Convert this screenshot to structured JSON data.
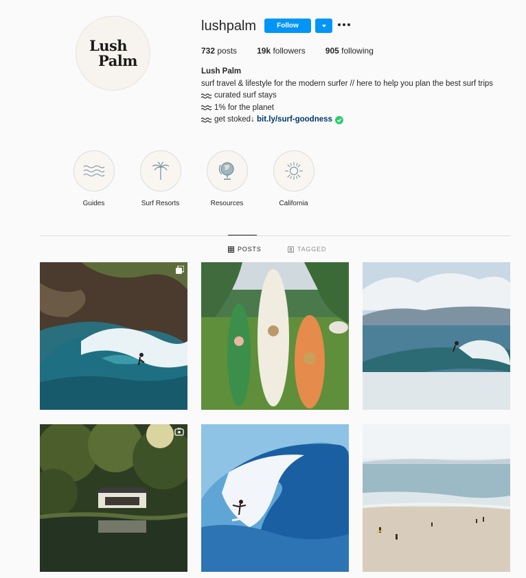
{
  "profile": {
    "username": "lushpalm",
    "avatar_line1": "Lush",
    "avatar_line2": "Palm",
    "follow_label": "Follow",
    "stats": {
      "posts_count": "732",
      "posts_label": "posts",
      "followers_count": "19k",
      "followers_label": "followers",
      "following_count": "905",
      "following_label": "following"
    },
    "bio": {
      "name": "Lush Palm",
      "line1": "surf travel & lifestyle for the modern surfer // here to help you plan the best surf trips",
      "line2": "curated surf stays",
      "line3": "1% for the planet",
      "line4_text": "get stoked↓ ",
      "link": "bit.ly/surf-goodness"
    }
  },
  "highlights": [
    {
      "label": "Guides",
      "icon": "waves-icon"
    },
    {
      "label": "Surf Resorts",
      "icon": "palm-tree-icon"
    },
    {
      "label": "Resources",
      "icon": "globe-icon"
    },
    {
      "label": "California",
      "icon": "sun-icon"
    }
  ],
  "tabs": {
    "posts": "POSTS",
    "tagged": "TAGGED"
  },
  "posts": [
    {
      "subject": "surfer riding barrel near rocky cliff",
      "badge": "multiple-posts-icon"
    },
    {
      "subject": "three surfboards with horse in field"
    },
    {
      "subject": "surfer on wave near mountains"
    },
    {
      "subject": "cabin in jungle reflected in pond",
      "badge": "igtv-icon"
    },
    {
      "subject": "surfer under large blue wave"
    },
    {
      "subject": "beach with surfers and shore"
    }
  ],
  "colors": {
    "accent": "#0095f6",
    "text": "#262626",
    "muted": "#8e8e8e",
    "link": "#00376b",
    "verified": "#2ecc71",
    "background": "#fafafa"
  }
}
